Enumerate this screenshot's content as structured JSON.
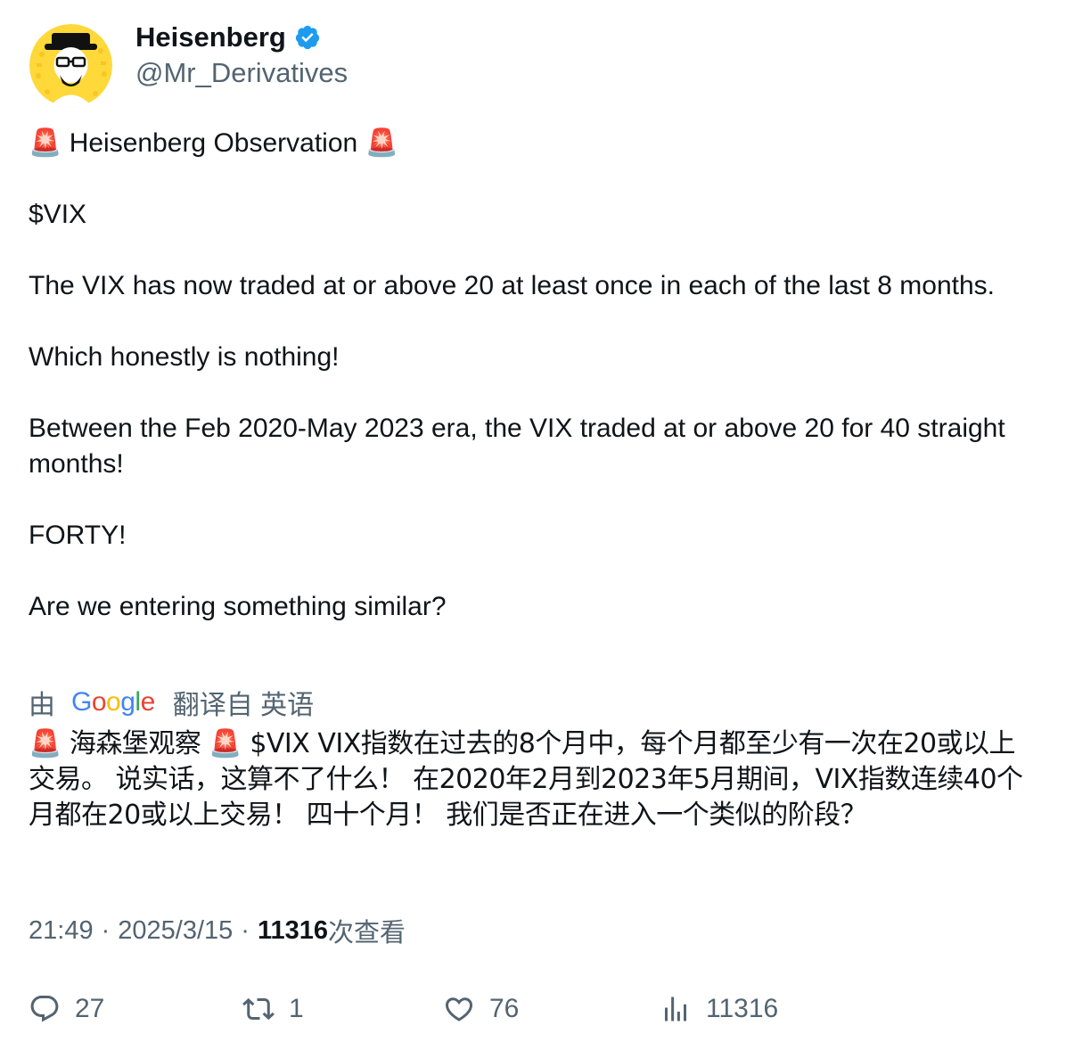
{
  "author": {
    "display_name": "Heisenberg",
    "handle": "@Mr_Derivatives",
    "verified": true,
    "avatar_icon": "heisenberg-cartoon-avatar"
  },
  "tweet": {
    "paragraphs": [
      "🚨 Heisenberg Observation 🚨",
      "$VIX",
      "The VIX has now traded at or above 20 at least once in each of the last 8 months.",
      "Which honestly is nothing!",
      "Between the Feb 2020-May 2023 era, the VIX traded at or above 20 for 40 straight months!",
      "FORTY!",
      "Are we entering something similar?"
    ]
  },
  "translation": {
    "prefix": "由",
    "provider_logo": "Google",
    "link_text": "翻译自 英语",
    "text": "🚨 海森堡观察 🚨 $VIX VIX指数在过去的8个月中，每个月都至少有一次在20或以上交易。 说实话，这算不了什么！ 在2020年2月到2023年5月期间，VIX指数连续40个月都在20或以上交易！ 四十个月！ 我们是否正在进入一个类似的阶段？"
  },
  "meta": {
    "time": "21:49",
    "separator": "·",
    "date": "2025/3/15",
    "views_count": "11316",
    "views_label": "次查看"
  },
  "actions": {
    "replies": "27",
    "retweets": "1",
    "likes": "76",
    "views": "11316"
  },
  "colors": {
    "text_primary": "#0f1419",
    "text_secondary": "#536471",
    "verified_blue": "#1d9bf0",
    "avatar_yellow": "#ffd83a"
  }
}
